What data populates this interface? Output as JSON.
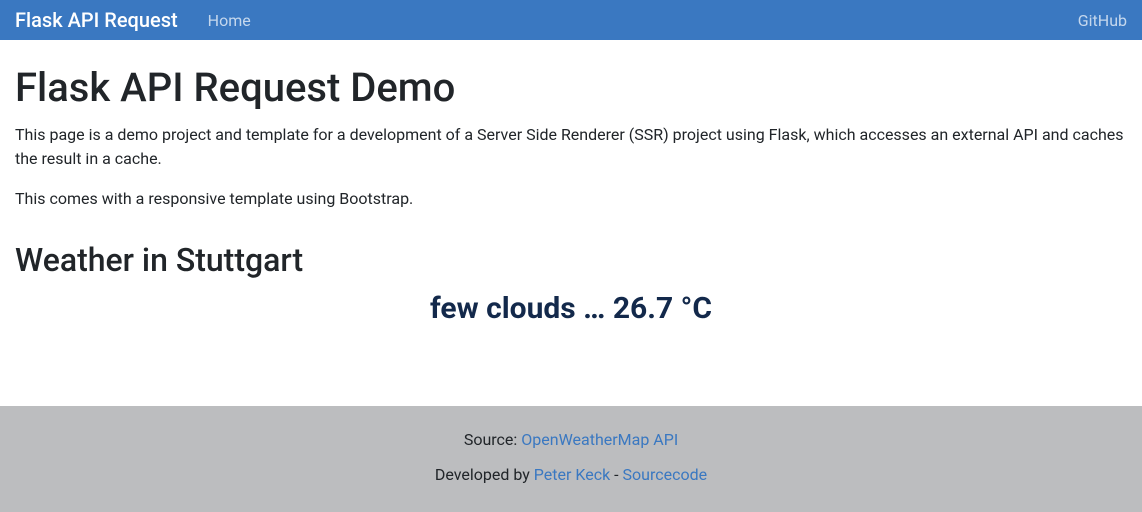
{
  "navbar": {
    "brand": "Flask API Request",
    "home_label": "Home",
    "github_label": "GitHub"
  },
  "main": {
    "title": "Flask API Request Demo",
    "intro_paragraph_1": "This page is a demo project and template for a development of a Server Side Renderer (SSR) project using Flask, which accesses an external API and caches the result in a cache.",
    "intro_paragraph_2": "This comes with a responsive template using Bootstrap.",
    "section_title": "Weather in Stuttgart",
    "weather_text": "few clouds … 26.7 °C"
  },
  "footer": {
    "source_prefix": "Source: ",
    "source_link": "OpenWeatherMap API",
    "developed_prefix": "Developed by ",
    "developer_link": "Peter Keck",
    "separator": " - ",
    "sourcecode_link": "Sourcecode"
  }
}
